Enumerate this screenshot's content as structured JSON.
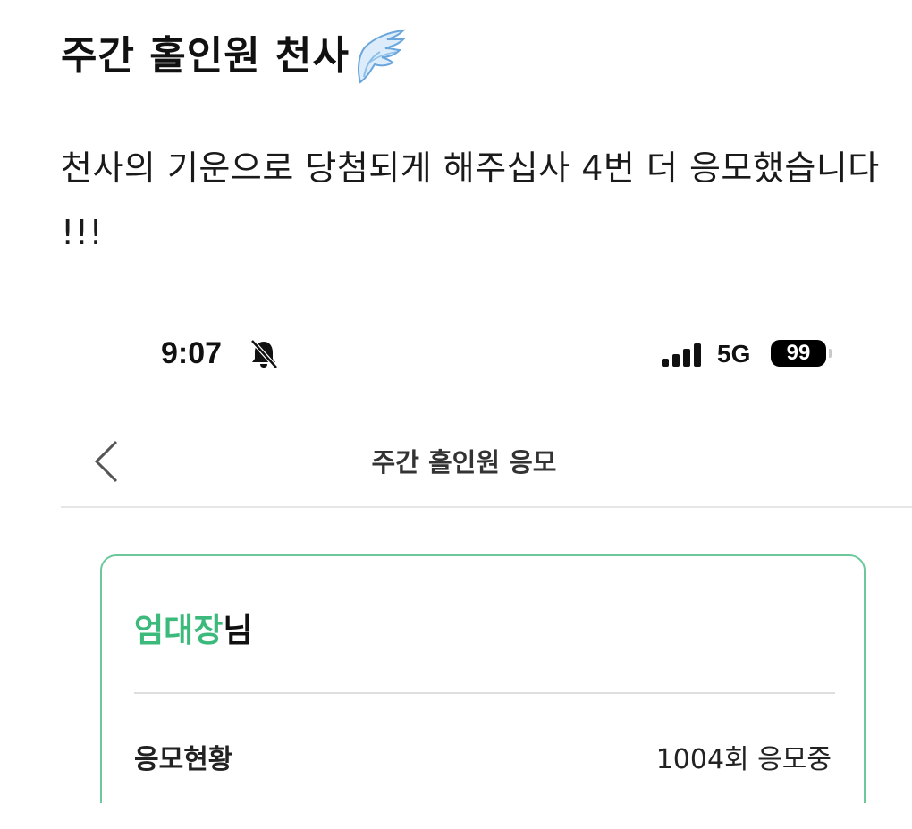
{
  "post": {
    "title": "주간 홀인원 천사",
    "title_icon": "angel-wing-icon",
    "body": "천사의 기운으로 당첨되게 해주십사 4번 더 응모했습니다 !!!"
  },
  "screenshot": {
    "status_bar": {
      "time": "9:07",
      "silent_icon": "bell-slash-icon",
      "signal_icon": "cellular-signal-icon",
      "network": "5G",
      "battery": "99"
    },
    "nav": {
      "back_icon": "chevron-left-icon",
      "title": "주간 홀인원 응모"
    },
    "card": {
      "user_name": "엄대장",
      "user_suffix": "님",
      "status_label": "응모현황",
      "status_value": "1004회 응모중"
    }
  },
  "colors": {
    "accent_green": "#3cba7c",
    "card_border": "#6cc89a",
    "wing_blue": "#7fb6e6"
  }
}
